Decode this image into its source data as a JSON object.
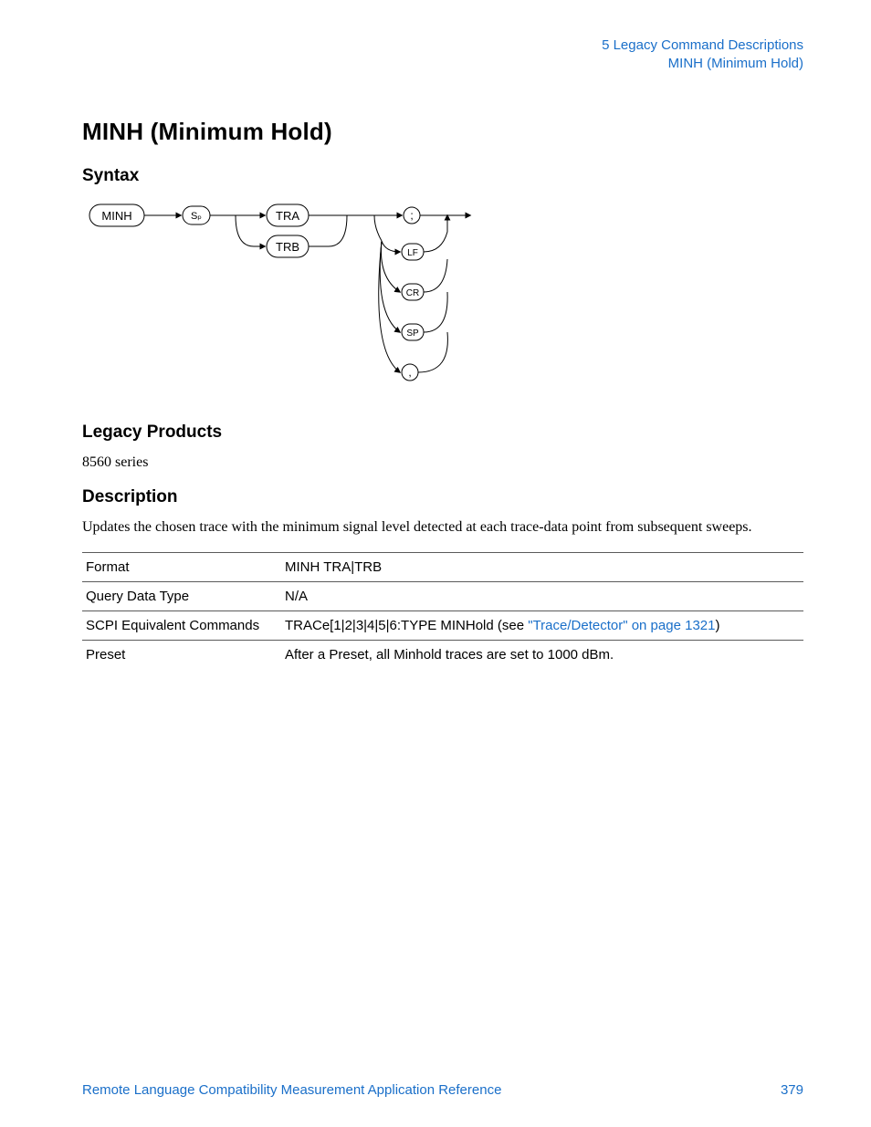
{
  "header": {
    "chapter": "5  Legacy Command Descriptions",
    "command": "MINH (Minimum Hold)"
  },
  "title": "MINH (Minimum Hold)",
  "sections": {
    "syntax": "Syntax",
    "legacy_products": "Legacy Products",
    "description": "Description"
  },
  "diagram": {
    "start": "MINH",
    "sep": "Sₚ",
    "options": [
      "TRA",
      "TRB"
    ],
    "terminators": [
      ";",
      "LF",
      "CR",
      "SP",
      ","
    ]
  },
  "legacy_products_text": "8560 series",
  "description_text": "Updates the chosen trace with the minimum signal level detected at each trace-data point from subsequent sweeps.",
  "table": {
    "rows": [
      {
        "label": "Format",
        "value_pre": "MINH TRA|TRB",
        "link": "",
        "value_post": ""
      },
      {
        "label": "Query Data Type",
        "value_pre": "N/A",
        "link": "",
        "value_post": ""
      },
      {
        "label": "SCPI Equivalent Commands",
        "value_pre": "TRACe[1|2|3|4|5|6:TYPE MINHold (see ",
        "link": "\"Trace/Detector\" on page 1321",
        "value_post": ")"
      },
      {
        "label": "Preset",
        "value_pre": "After a Preset, all Minhold traces are set to 1000 dBm.",
        "link": "",
        "value_post": ""
      }
    ]
  },
  "footer": {
    "doc": "Remote Language Compatibility Measurement Application Reference",
    "page": "379"
  }
}
